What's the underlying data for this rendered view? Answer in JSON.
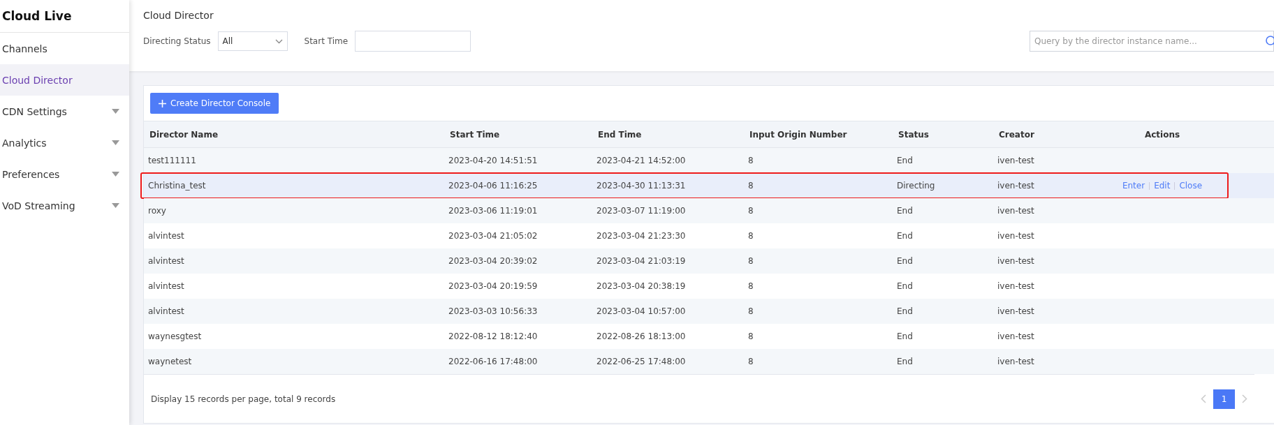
{
  "sidebar": {
    "title": "Cloud Live",
    "items": [
      {
        "label": "Channels",
        "kind": "link",
        "selected": false
      },
      {
        "label": "Cloud Director",
        "kind": "link",
        "selected": true
      },
      {
        "label": "CDN Settings",
        "kind": "group",
        "selected": false,
        "expanded": false
      },
      {
        "label": "Analytics",
        "kind": "group",
        "selected": false,
        "expanded": false
      },
      {
        "label": "Preferences",
        "kind": "group",
        "selected": false,
        "expanded": false
      },
      {
        "label": "VoD Streaming",
        "kind": "group",
        "selected": false,
        "expanded": false
      }
    ]
  },
  "header": {
    "title": "Cloud Director",
    "filters": [
      {
        "label": "Directing Status",
        "kind": "select",
        "value": "All"
      },
      {
        "label": "Start Time",
        "kind": "input"
      }
    ],
    "search": {
      "placeholder": "Query by the director instance name..."
    }
  },
  "create_button": {
    "label": "Create Director Console"
  },
  "table": {
    "columns": [
      "Director Name",
      "Start Time",
      "End Time",
      "Input Origin Number",
      "Status",
      "Creator",
      "Actions"
    ],
    "rows": [
      {
        "cells": [
          "test111111",
          "2023-04-20 14:51:51",
          "2023-04-21 14:52:00",
          "8",
          "End",
          "iven-test"
        ],
        "actions": [],
        "highlighted": false
      },
      {
        "cells": [
          "Christina_test",
          "2023-04-06 11:16:25",
          "2023-04-30 11:13:31",
          "8",
          "Directing",
          "iven-test"
        ],
        "actions": [
          "Enter",
          "Edit",
          "Close"
        ],
        "highlighted": true
      },
      {
        "cells": [
          "roxy",
          "2023-03-06 11:19:01",
          "2023-03-07 11:19:00",
          "8",
          "End",
          "iven-test"
        ],
        "actions": [],
        "highlighted": false
      },
      {
        "cells": [
          "alvintest",
          "2023-03-04 21:05:02",
          "2023-03-04 21:23:30",
          "8",
          "End",
          "iven-test"
        ],
        "actions": [],
        "highlighted": false
      },
      {
        "cells": [
          "alvintest",
          "2023-03-04 20:39:02",
          "2023-03-04 21:03:19",
          "8",
          "End",
          "iven-test"
        ],
        "actions": [],
        "highlighted": false
      },
      {
        "cells": [
          "alvintest",
          "2023-03-04 20:19:59",
          "2023-03-04 20:38:19",
          "8",
          "End",
          "iven-test"
        ],
        "actions": [],
        "highlighted": false
      },
      {
        "cells": [
          "alvintest",
          "2023-03-03 10:56:33",
          "2023-03-04 10:57:00",
          "8",
          "End",
          "iven-test"
        ],
        "actions": [],
        "highlighted": false
      },
      {
        "cells": [
          "waynesgtest",
          "2022-08-12 18:12:40",
          "2022-08-26 18:13:00",
          "8",
          "End",
          "iven-test"
        ],
        "actions": [],
        "highlighted": false
      },
      {
        "cells": [
          "waynetest",
          "2022-06-16 17:48:00",
          "2022-06-25 17:48:00",
          "8",
          "End",
          "iven-test"
        ],
        "actions": [],
        "highlighted": false
      }
    ]
  },
  "footer": {
    "summary": "Display 15 records per page, total 9 records",
    "pages": [
      {
        "label": "1",
        "selected": true
      }
    ]
  }
}
